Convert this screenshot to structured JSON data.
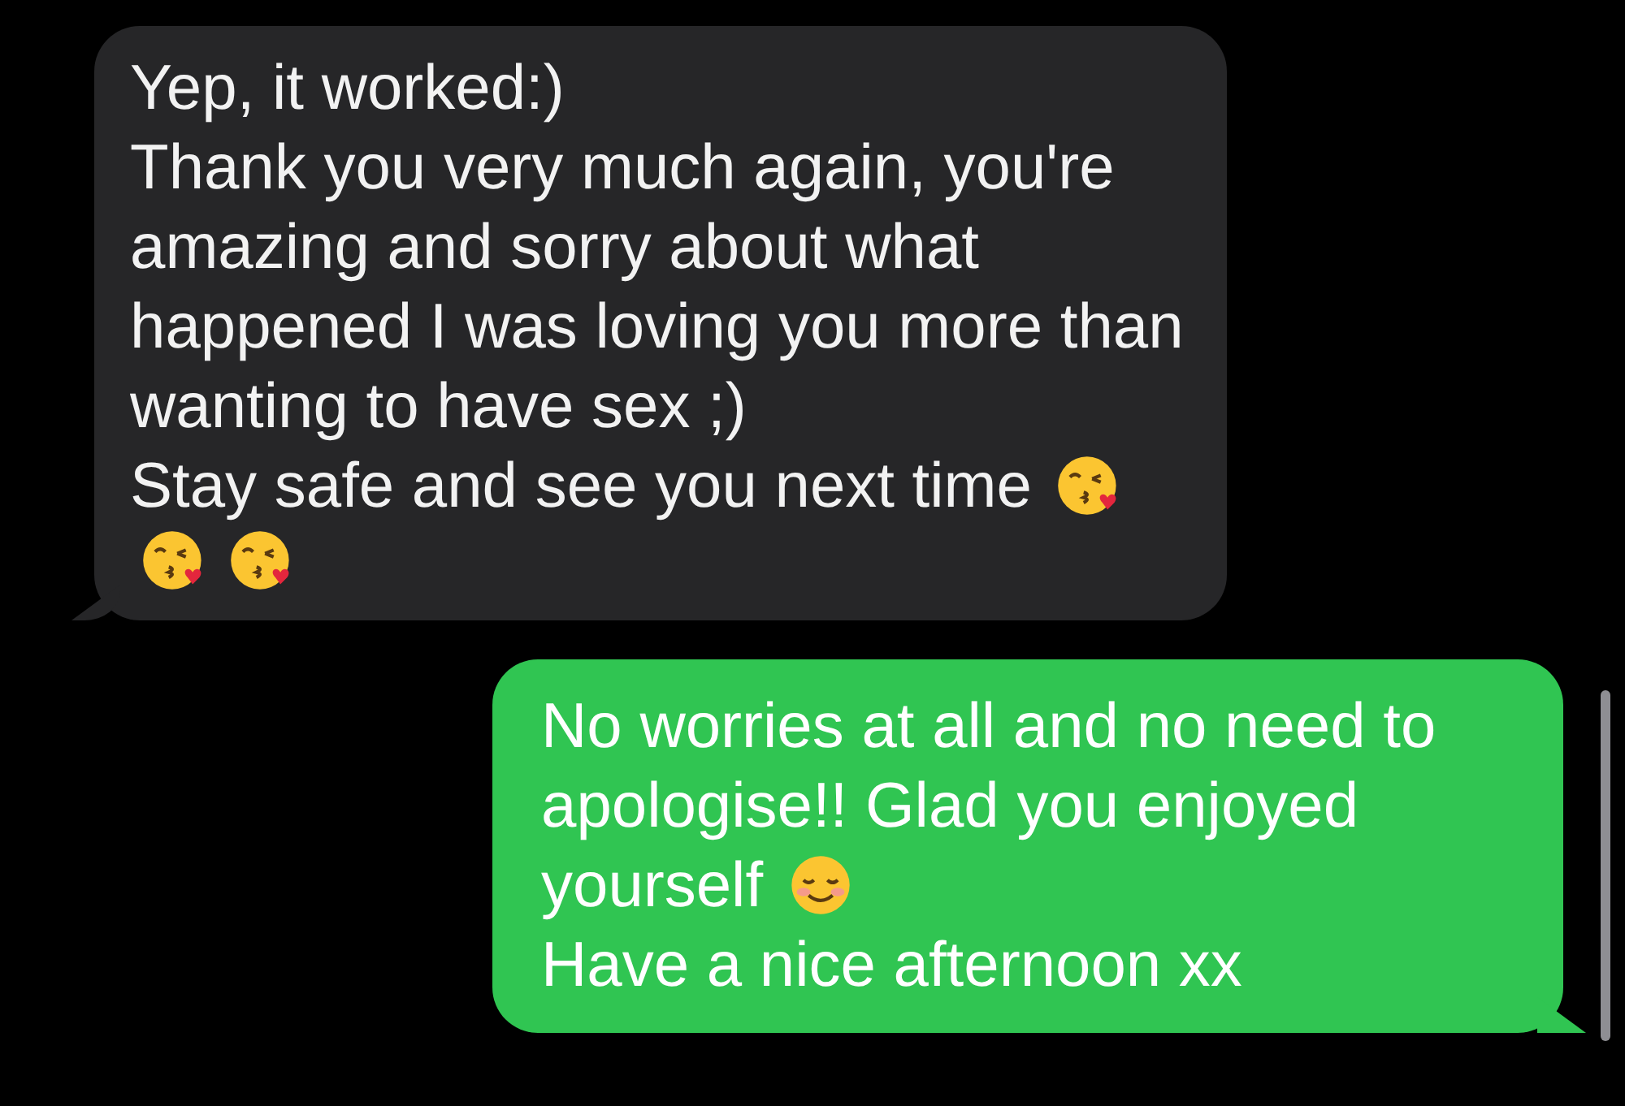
{
  "messages": [
    {
      "kind": "received",
      "paragraphs": [
        {
          "parts": [
            {
              "kind": "text",
              "text": "Yep, it worked:)"
            }
          ]
        },
        {
          "parts": [
            {
              "kind": "text",
              "text": "Thank you very much again, you're amazing and sorry about what happened I was loving you more than wanting to have sex ;)"
            }
          ]
        },
        {
          "parts": [
            {
              "kind": "text",
              "text": "Stay safe and see you next time"
            },
            {
              "kind": "kiss"
            },
            {
              "kind": "kiss"
            },
            {
              "kind": "kiss"
            }
          ]
        }
      ]
    },
    {
      "kind": "sent",
      "paragraphs": [
        {
          "parts": [
            {
              "kind": "text",
              "text": "No worries at all and no need to apologise!! Glad you enjoyed"
            },
            {
              "kind": "text",
              "text": "yourself"
            },
            {
              "kind": "blush"
            }
          ]
        },
        {
          "parts": [
            {
              "kind": "text",
              "text": "Have a nice afternoon xx"
            }
          ]
        }
      ]
    }
  ]
}
